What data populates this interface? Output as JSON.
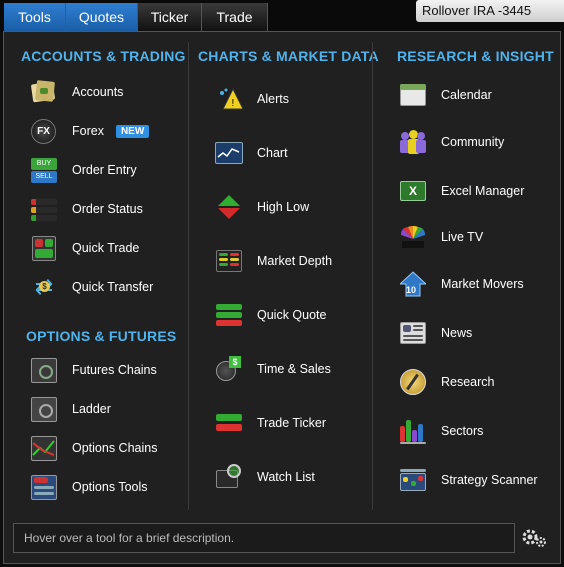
{
  "tabs": [
    {
      "label": "Tools"
    },
    {
      "label": "Quotes"
    },
    {
      "label": "Ticker"
    },
    {
      "label": "Trade"
    }
  ],
  "account": "Rollover IRA -3445",
  "sections": {
    "accounts_trading": {
      "title": "ACCOUNTS & TRADING",
      "items": [
        {
          "label": "Accounts",
          "icon": "accounts-icon"
        },
        {
          "label": "Forex",
          "icon": "fx-icon",
          "badge": "NEW"
        },
        {
          "label": "Order Entry",
          "icon": "buy-sell-icon"
        },
        {
          "label": "Order Status",
          "icon": "order-status-icon"
        },
        {
          "label": "Quick Trade",
          "icon": "quick-trade-icon"
        },
        {
          "label": "Quick Transfer",
          "icon": "transfer-icon"
        }
      ]
    },
    "options_futures": {
      "title": "OPTIONS & FUTURES",
      "items": [
        {
          "label": "Futures Chains",
          "icon": "futures-chains-icon"
        },
        {
          "label": "Ladder",
          "icon": "ladder-icon"
        },
        {
          "label": "Options Chains",
          "icon": "options-chains-icon"
        },
        {
          "label": "Options Tools",
          "icon": "options-tools-icon"
        }
      ]
    },
    "charts_market": {
      "title": "CHARTS & MARKET DATA",
      "items": [
        {
          "label": "Alerts",
          "icon": "alerts-icon"
        },
        {
          "label": "Chart",
          "icon": "chart-icon"
        },
        {
          "label": "High Low",
          "icon": "high-low-icon"
        },
        {
          "label": "Market Depth",
          "icon": "market-depth-icon"
        },
        {
          "label": "Quick Quote",
          "icon": "quick-quote-icon"
        },
        {
          "label": "Time & Sales",
          "icon": "time-sales-icon"
        },
        {
          "label": "Trade Ticker",
          "icon": "trade-ticker-icon"
        },
        {
          "label": "Watch List",
          "icon": "watch-list-icon"
        }
      ]
    },
    "research_insight": {
      "title": "RESEARCH & INSIGHT",
      "items": [
        {
          "label": "Calendar",
          "icon": "calendar-icon"
        },
        {
          "label": "Community",
          "icon": "community-icon"
        },
        {
          "label": "Excel Manager",
          "icon": "excel-icon"
        },
        {
          "label": "Live TV",
          "icon": "live-tv-icon"
        },
        {
          "label": "Market Movers",
          "icon": "market-movers-icon"
        },
        {
          "label": "News",
          "icon": "news-icon"
        },
        {
          "label": "Research",
          "icon": "research-icon"
        },
        {
          "label": "Sectors",
          "icon": "sectors-icon"
        },
        {
          "label": "Strategy Scanner",
          "icon": "strategy-scanner-icon"
        }
      ]
    }
  },
  "footer": {
    "hint": "Hover over a tool for a brief description."
  },
  "colors": {
    "section_title": "#4fb3ec",
    "active_tab": "#2f7fd1",
    "panel_bg": "#202020"
  }
}
